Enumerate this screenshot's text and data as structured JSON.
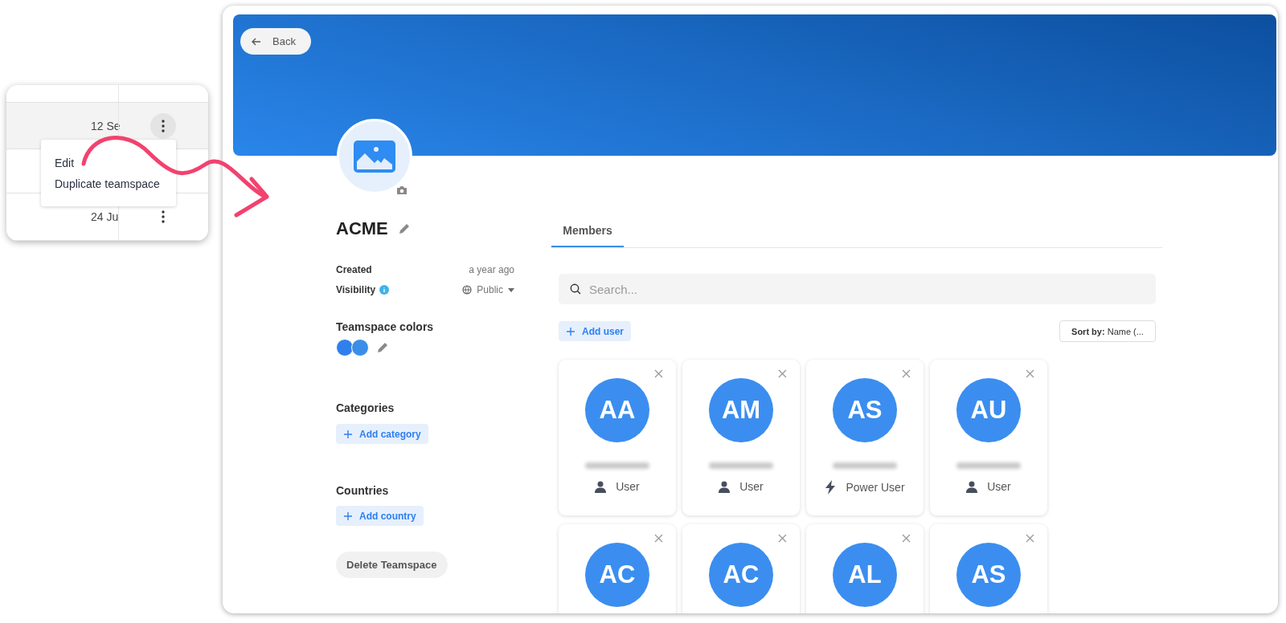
{
  "table_popup": {
    "rows": [
      {
        "highlighted": false,
        "has_menu": false
      },
      {
        "date": "12 Se",
        "highlighted": true,
        "has_menu": true
      },
      {
        "highlighted": false,
        "has_menu": false
      },
      {
        "date": "24 Ju",
        "highlighted": false,
        "has_menu": true
      }
    ],
    "menu": [
      "Edit",
      "Duplicate teamspace"
    ]
  },
  "back_button": "Back",
  "teamspace": {
    "name": "ACME",
    "created_label": "Created",
    "created_value": "a year ago",
    "visibility_label": "Visibility",
    "visibility_value": "Public",
    "colors_label": "Teamspace colors",
    "colors": [
      {
        "color": "#2f80ed"
      },
      {
        "color": "#3a8ee8"
      }
    ],
    "categories_label": "Categories",
    "add_category": "Add category",
    "countries_label": "Countries",
    "add_country": "Add country",
    "delete_button": "Delete Teamspace"
  },
  "tabs": [
    {
      "label": "Members",
      "selected": true
    }
  ],
  "search": {
    "placeholder": "Search..."
  },
  "add_user": "Add user",
  "sort": "**Sort by:** Name (...",
  "members": [
    {
      "initials": "AA",
      "role": "User",
      "kind": "user"
    },
    {
      "initials": "AM",
      "role": "User",
      "kind": "user"
    },
    {
      "initials": "AS",
      "role": "Power User",
      "kind": "power_user"
    },
    {
      "initials": "AU",
      "role": "User",
      "kind": "user"
    },
    {
      "initials": "AC"
    },
    {
      "initials": "AC"
    },
    {
      "initials": "AL"
    },
    {
      "initials": "AS"
    }
  ]
}
